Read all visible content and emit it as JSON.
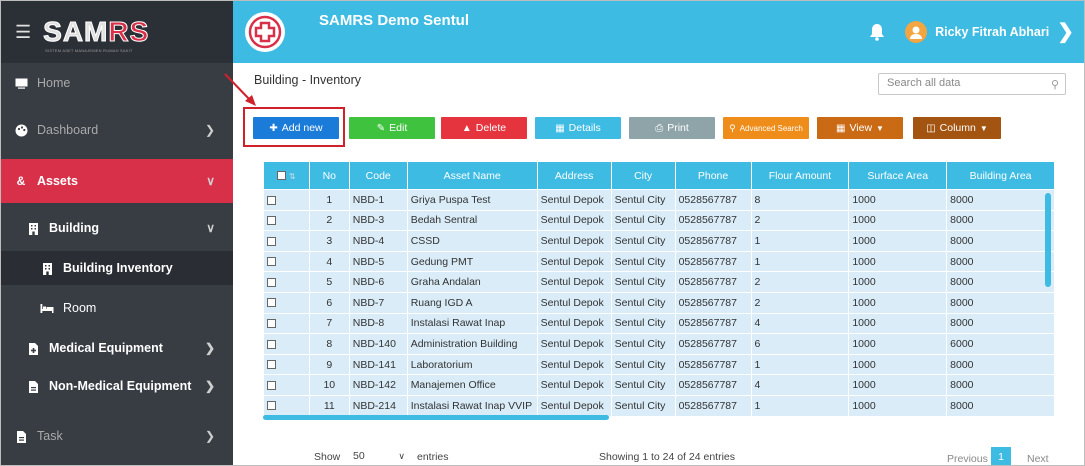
{
  "brand": {
    "name_a": "SAM",
    "name_b": "RS",
    "subtitle": "SISTEM ASET MANAJEMEN RUMAH SAKIT"
  },
  "header": {
    "title": "SAMRS Demo Sentul",
    "user": "Ricky Fitrah Abhari"
  },
  "sidebar": {
    "home": "Home",
    "dashboard": "Dashboard",
    "assets": "Assets",
    "building": "Building",
    "building_inventory": "Building Inventory",
    "room": "Room",
    "medical": "Medical Equipment",
    "non_medical": "Non-Medical Equipment",
    "task": "Task"
  },
  "page": {
    "title": "Building - Inventory",
    "search_placeholder": "Search all data"
  },
  "toolbar": {
    "add": "Add new",
    "edit": "Edit",
    "delete": "Delete",
    "details": "Details",
    "print": "Print",
    "advanced": "Advanced Search",
    "view": "View",
    "column": "Column",
    "colors": {
      "add": "#1a7bd8",
      "edit": "#3fc33f",
      "delete": "#e5343e",
      "details": "#3dbbe3",
      "print": "#8fa4a9",
      "advanced": "#ef8d1a",
      "view": "#ca6a14",
      "column": "#a35410"
    }
  },
  "table": {
    "headers": [
      "No",
      "Code",
      "Asset Name",
      "Address",
      "City",
      "Phone",
      "Flour Amount",
      "Surface Area",
      "Building Area"
    ],
    "rows": [
      [
        "1",
        "NBD-1",
        "Griya Puspa Test",
        "Sentul Depok",
        "Sentul City",
        "0528567787",
        "8",
        "1000",
        "8000"
      ],
      [
        "2",
        "NBD-3",
        "Bedah Sentral",
        "Sentul Depok",
        "Sentul City",
        "0528567787",
        "2",
        "1000",
        "8000"
      ],
      [
        "3",
        "NBD-4",
        "CSSD",
        "Sentul Depok",
        "Sentul City",
        "0528567787",
        "1",
        "1000",
        "8000"
      ],
      [
        "4",
        "NBD-5",
        "Gedung PMT",
        "Sentul Depok",
        "Sentul City",
        "0528567787",
        "1",
        "1000",
        "8000"
      ],
      [
        "5",
        "NBD-6",
        "Graha Andalan",
        "Sentul Depok",
        "Sentul City",
        "0528567787",
        "2",
        "1000",
        "8000"
      ],
      [
        "6",
        "NBD-7",
        "Ruang IGD A",
        "Sentul Depok",
        "Sentul City",
        "0528567787",
        "2",
        "1000",
        "8000"
      ],
      [
        "7",
        "NBD-8",
        "Instalasi Rawat Inap",
        "Sentul Depok",
        "Sentul City",
        "0528567787",
        "4",
        "1000",
        "8000"
      ],
      [
        "8",
        "NBD-140",
        "Administration Building",
        "Sentul Depok",
        "Sentul City",
        "0528567787",
        "6",
        "1000",
        "6000"
      ],
      [
        "9",
        "NBD-141",
        "Laboratorium",
        "Sentul Depok",
        "Sentul City",
        "0528567787",
        "1",
        "1000",
        "8000"
      ],
      [
        "10",
        "NBD-142",
        "Manajemen Office",
        "Sentul Depok",
        "Sentul City",
        "0528567787",
        "4",
        "1000",
        "8000"
      ],
      [
        "11",
        "NBD-214",
        "Instalasi Rawat Inap VVIP",
        "Sentul Depok",
        "Sentul City",
        "0528567787",
        "1",
        "1000",
        "8000"
      ]
    ]
  },
  "footer": {
    "show": "Show",
    "entries_value": "50",
    "entries": "entries",
    "info": "Showing 1 to 24 of 24 entries",
    "previous": "Previous",
    "page": "1",
    "next": "Next"
  }
}
